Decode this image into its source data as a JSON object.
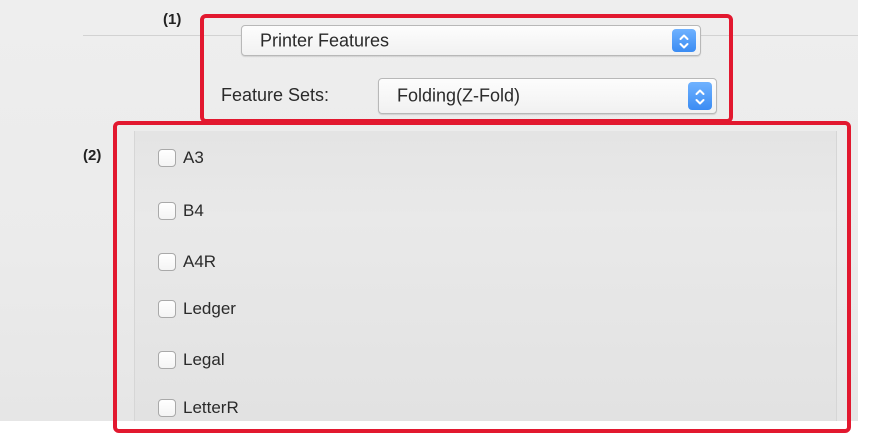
{
  "callouts": {
    "one": "(1)",
    "two": "(2)"
  },
  "printer_popup": {
    "value": "Printer Features",
    "icon": "up-down-arrows-icon"
  },
  "feature_sets": {
    "label": "Feature Sets:",
    "value": "Folding(Z-Fold)",
    "icon": "up-down-arrows-icon"
  },
  "options": [
    {
      "label": "A3",
      "checked": false
    },
    {
      "label": "B4",
      "checked": false
    },
    {
      "label": "A4R",
      "checked": false
    },
    {
      "label": "Ledger",
      "checked": false
    },
    {
      "label": "Legal",
      "checked": false
    },
    {
      "label": "LetterR",
      "checked": false
    }
  ],
  "colors": {
    "highlight": "#e2182f",
    "stepper": "#3b8cf3"
  }
}
